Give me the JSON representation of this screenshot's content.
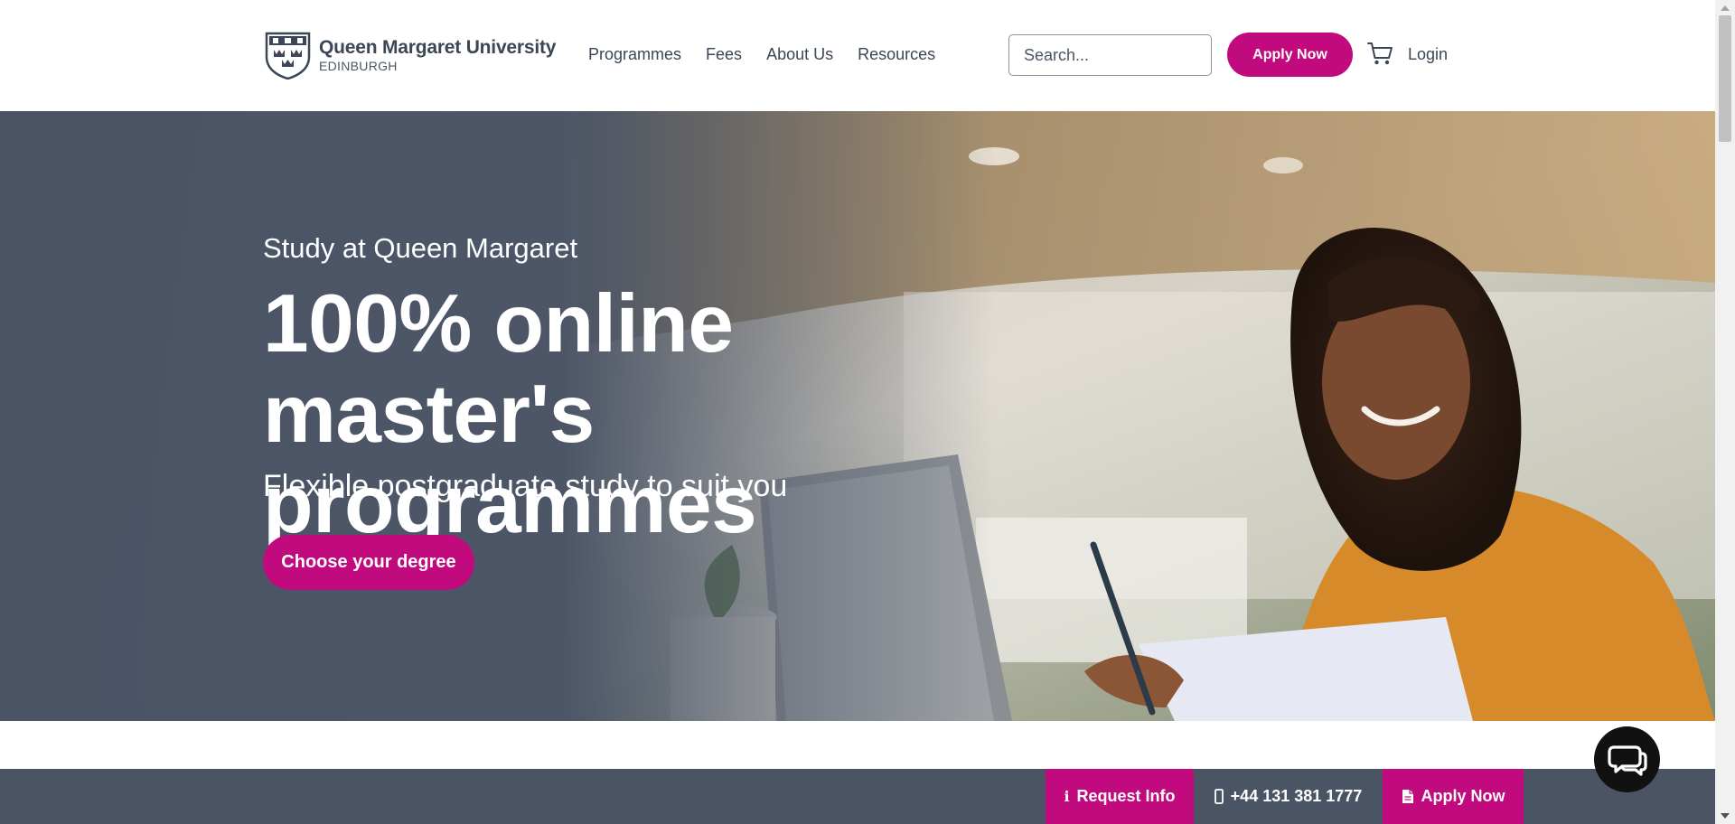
{
  "header": {
    "logo_name": "Queen Margaret University",
    "logo_sub": "EDINBURGH",
    "nav": [
      {
        "label": "Programmes"
      },
      {
        "label": "Fees"
      },
      {
        "label": "About Us"
      },
      {
        "label": "Resources"
      }
    ],
    "search_placeholder": "Search...",
    "apply_label": "Apply Now",
    "login_label": "Login"
  },
  "hero": {
    "eyebrow": "Study at Queen Margaret",
    "title": "100% online master's programmes",
    "subtitle": "Flexible postgraduate study to suit you",
    "cta_label": "Choose your degree"
  },
  "sticky_bar": {
    "request_label": "Request Info",
    "phone_label": "+44 131 381 1777",
    "apply_label": "Apply Now"
  },
  "colors": {
    "brand_magenta": "#c10a7d",
    "slate": "#4a5465",
    "text_dark": "#3b4656"
  },
  "icons": [
    "crest-logo-icon",
    "cart-icon",
    "info-icon",
    "phone-icon",
    "document-icon",
    "chat-icon"
  ]
}
